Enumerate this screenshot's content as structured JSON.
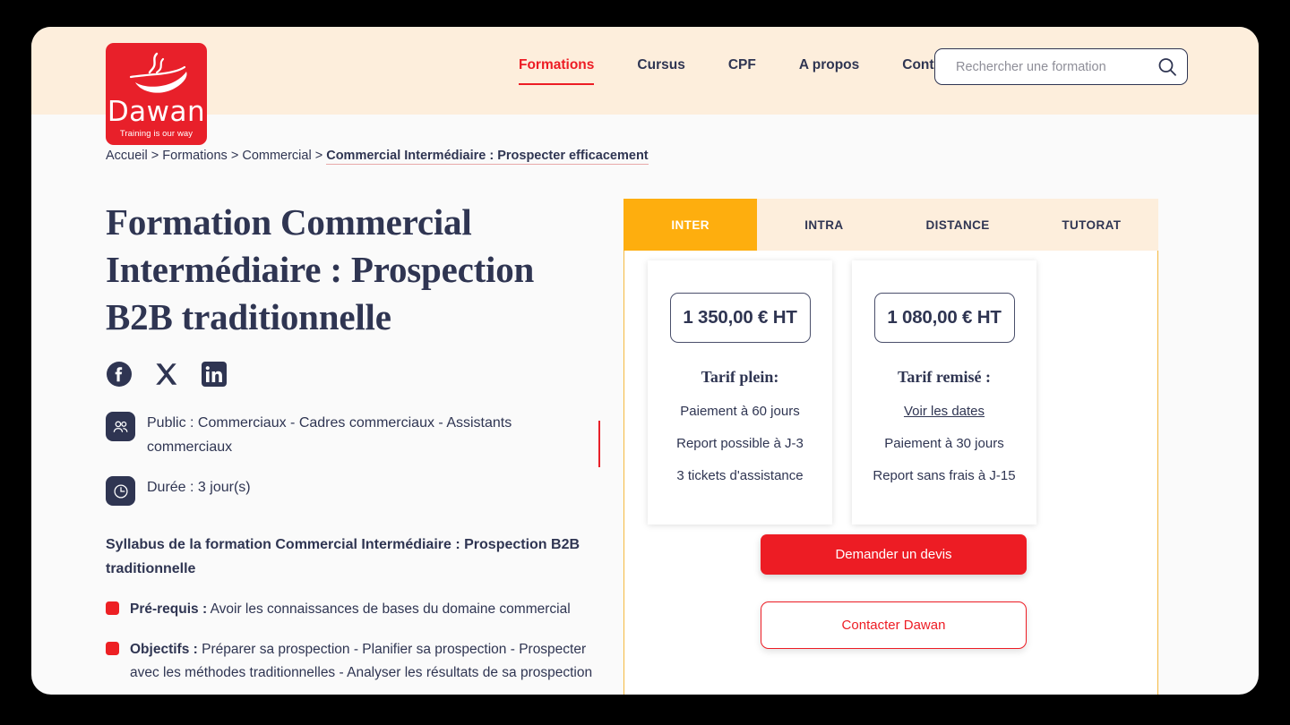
{
  "brand": {
    "logo_wordmark": "Dawan",
    "logo_tagline": "Training is our way",
    "logo_icon": "cup-steam-icon",
    "brand_red": "#e8202a",
    "accent_amber": "#feae0e",
    "navy": "#2f3552",
    "header_bg": "#fdeedc"
  },
  "nav": {
    "items": [
      {
        "label": "Formations",
        "active": true
      },
      {
        "label": "Cursus",
        "active": false
      },
      {
        "label": "CPF",
        "active": false
      },
      {
        "label": "A propos",
        "active": false
      },
      {
        "label": "Contact",
        "active": false
      }
    ]
  },
  "search": {
    "placeholder": "Rechercher une formation",
    "value": "",
    "icon": "search-icon"
  },
  "breadcrumb": {
    "items": [
      "Accueil",
      "Formations",
      "Commercial"
    ],
    "current": "Commercial Intermédiaire : Prospecter efficacement",
    "separator": ">"
  },
  "main": {
    "title": "Formation Commercial Intermédiaire : Prospection B2B traditionnelle",
    "social": [
      {
        "name": "facebook-icon",
        "label": "Facebook"
      },
      {
        "name": "x-twitter-icon",
        "label": "X"
      },
      {
        "name": "linkedin-icon",
        "label": "LinkedIn"
      }
    ],
    "info": [
      {
        "icon": "people-icon",
        "text": "Public : Commerciaux - Cadres commerciaux - Assistants commerciaux"
      },
      {
        "icon": "clock-icon",
        "text": "Durée : 3 jour(s)"
      }
    ],
    "syllabus_heading": "Syllabus de la formation Commercial Intermédiaire : Prospection B2B traditionnelle",
    "syllabus_items": [
      {
        "label": "Pré-requis :",
        "text": " Avoir les connaissances de bases du domaine commercial"
      },
      {
        "label": "Objectifs :",
        "text": " Préparer sa prospection - Planifier sa prospection - Prospecter avec les méthodes traditionnelles - Analyser les résultats de sa prospection"
      }
    ]
  },
  "offer_panel": {
    "tabs": [
      {
        "label": "INTER",
        "active": true
      },
      {
        "label": "INTRA",
        "active": false
      },
      {
        "label": "DISTANCE",
        "active": false
      },
      {
        "label": "TUTORAT",
        "active": false
      }
    ],
    "cards": [
      {
        "price": "1 350,00 € HT",
        "label": "Tarif plein:",
        "features": [
          {
            "text": "Paiement à 60 jours",
            "link": false
          },
          {
            "text": "Report possible à J-3",
            "link": false
          },
          {
            "text": "3 tickets d'assistance",
            "link": false
          }
        ]
      },
      {
        "price": "1 080,00 € HT",
        "label": "Tarif remisé :",
        "features": [
          {
            "text": "Voir les dates",
            "link": true
          },
          {
            "text": "Paiement à 30 jours",
            "link": false
          },
          {
            "text": "Report sans frais à J-15",
            "link": false
          }
        ]
      }
    ],
    "cta_primary": "Demander un devis",
    "cta_secondary": "Contacter Dawan"
  }
}
